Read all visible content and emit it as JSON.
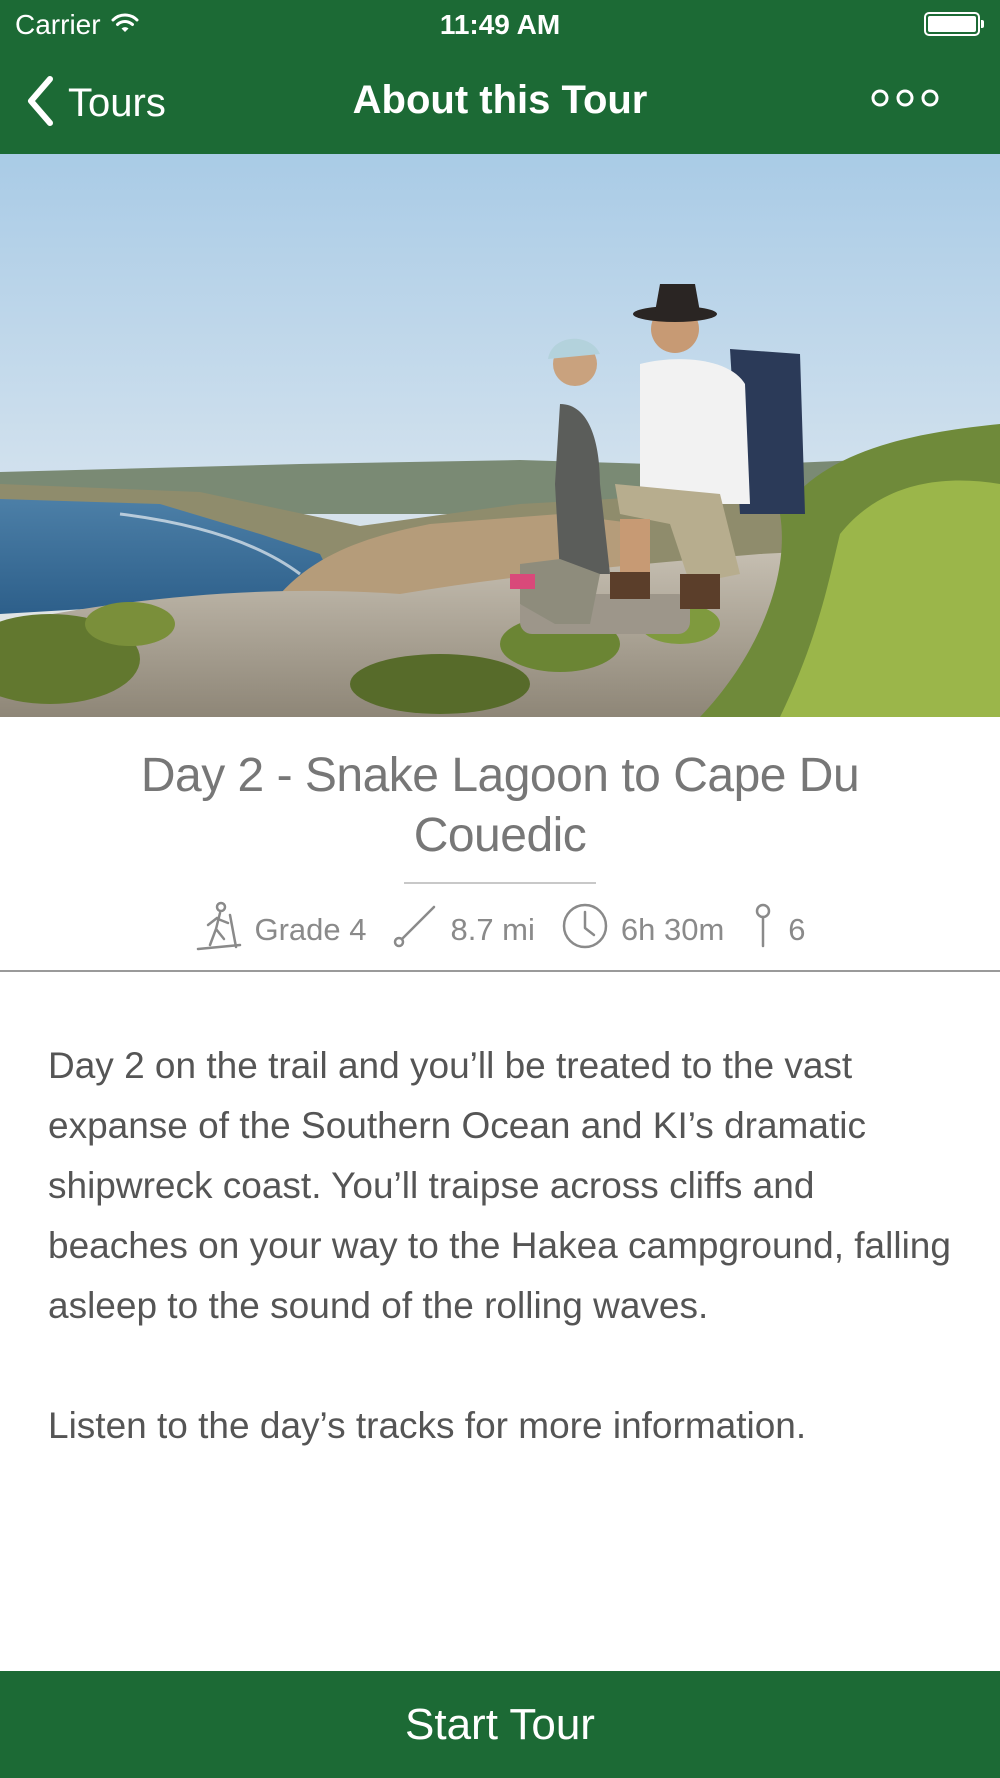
{
  "status_bar": {
    "carrier": "Carrier",
    "time": "11:49 AM",
    "icons": [
      "wifi-icon",
      "battery-icon"
    ]
  },
  "nav": {
    "back_label": "Tours",
    "title": "About this Tour",
    "icons": [
      "chevron-left-icon",
      "more-icon"
    ]
  },
  "hero": {
    "image_subject": "two hikers resting on rocky cliff overlooking coastline"
  },
  "tour": {
    "title": "Day 2 - Snake Lagoon to Cape Du Couedic",
    "stats": {
      "grade": "Grade 4",
      "distance": "8.7 mi",
      "duration": "6h 30m",
      "stops": "6"
    },
    "description": [
      "Day 2 on the trail and you’ll be treated to the vast expanse of the Southern Ocean and KI’s dramatic shipwreck coast. You’ll traipse across cliffs and beaches on your way to the Hakea campground, falling asleep to the sound of the rolling waves.",
      "Listen to the day’s tracks for more information."
    ]
  },
  "actions": {
    "start_label": "Start Tour"
  },
  "colors": {
    "brand_green": "#1c6a35",
    "text_gray": "#555555",
    "title_gray": "#777777"
  }
}
